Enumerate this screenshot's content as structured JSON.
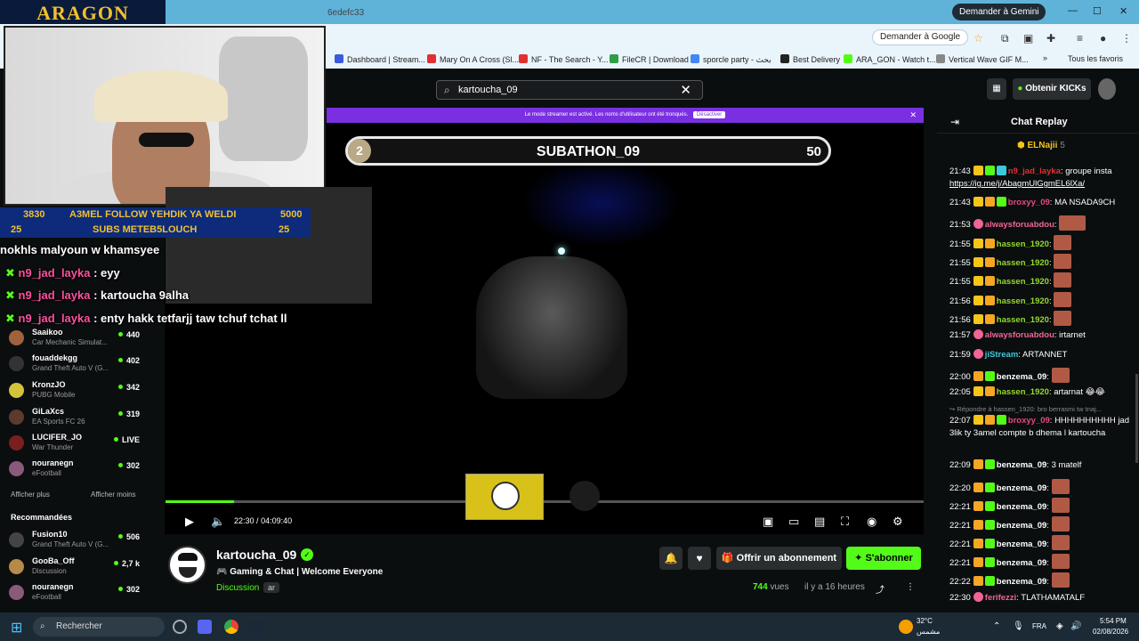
{
  "browser": {
    "gemini_label": "Demander à Gemini",
    "address_tail": "6edefc33",
    "google_btn": "Demander à Google",
    "bookmarks": [
      {
        "label": "Dashboard | Stream...",
        "color": "#3b5bdb"
      },
      {
        "label": "Mary On A Cross (Sl...",
        "color": "#e03131"
      },
      {
        "label": "NF - The Search - Y...",
        "color": "#e03131"
      },
      {
        "label": "FileCR | Download",
        "color": "#2f9e44"
      },
      {
        "label": "sporcle party - بحث",
        "color": "#4285f4"
      },
      {
        "label": "Best Delivery",
        "color": "#222222"
      },
      {
        "label": "ARA_GON - Watch t...",
        "color": "#53fc18"
      },
      {
        "label": "Vertical Wave GIF M...",
        "color": "#888888"
      }
    ],
    "bookmarks_all": "Tous les favoris"
  },
  "kick": {
    "search_value": "kartoucha_09",
    "get_kicks": "Obtenir KICKs",
    "streamer_banner": "Le mode streamer est activé. Les noms d'utilisateur ont été tronqués.",
    "streamer_banner_btn": "Désactiver"
  },
  "overlay": {
    "logo": "ARAGON",
    "goal1_left": "3830",
    "goal1_text": "A3MEL FOLLOW YEHDIK YA WELDI",
    "goal1_right": "5000",
    "goal2_left": "25",
    "goal2_text": "SUBS METEB5LOUCH",
    "goal2_right": "25",
    "messages": [
      {
        "user": "",
        "text": "nokhls malyoun w khamsyee"
      },
      {
        "user": "n9_jad_layka",
        "text": ": eyy"
      },
      {
        "user": "n9_jad_layka",
        "text": ": kartoucha 9alha"
      },
      {
        "user": "n9_jad_layka",
        "text": ": enty hakk tetfarjj taw tchuf tchat ll"
      }
    ],
    "subathon_num": "2",
    "subathon_title": "SUBATHON_09",
    "subathon_right": "50"
  },
  "sidebar": {
    "items": [
      {
        "name": "Saaikoo",
        "cat": "Car Mechanic Simulat...",
        "val": "440"
      },
      {
        "name": "fouaddekgg",
        "cat": "Grand Theft Auto V (G...",
        "val": "402"
      },
      {
        "name": "KronzJO",
        "cat": "PUBG Mobile",
        "val": "342"
      },
      {
        "name": "GiLaXcs",
        "cat": "EA Sports FC 26",
        "val": "319"
      },
      {
        "name": "LUCIFER_JO",
        "cat": "War Thunder",
        "val": "LIVE"
      },
      {
        "name": "nouranegn",
        "cat": "eFootball",
        "val": "302"
      }
    ],
    "show_more": "Afficher plus",
    "show_less": "Afficher moins",
    "recommended": "Recommandées",
    "rec_items": [
      {
        "name": "Fusion10",
        "cat": "Grand Theft Auto V (G...",
        "val": "506"
      },
      {
        "name": "GooBa_Off",
        "cat": "Discussion",
        "val": "2,7 k"
      },
      {
        "name": "nouranegn",
        "cat": "eFootball",
        "val": "302"
      }
    ]
  },
  "player": {
    "time_current": "22:30",
    "time_sep": "/",
    "time_total": "04:09:40",
    "progress": 0.09
  },
  "channel": {
    "name": "kartoucha_09",
    "title": "Gaming & Chat | Welcome Everyone",
    "category": "Discussion",
    "lang": "ar",
    "subscribe_gift": "Offrir un abonnement",
    "subscribe": "S'abonner",
    "viewers": "744",
    "viewers_label": "vues",
    "ago": "il y a 16 heures"
  },
  "chat": {
    "title": "Chat Replay",
    "pinned_user": "ELNajii",
    "pinned_count": "5",
    "reply_note": "Répondre à hassen_1920: bro berrasmi tw tnaj...",
    "messages": [
      {
        "t": "21:43",
        "user": "n9_jad_layka",
        "color": "#e03131",
        "text": ": groupe insta",
        "link": "https://ig.me/j/AbagmUlGgmEL6lXa/"
      },
      {
        "t": "21:43",
        "user": "broxyy_09",
        "color": "#e64980",
        "text": ": MA NSADA9CH"
      },
      {
        "t": "21:53",
        "user": "alwaysforuabdou",
        "color": "#f06595",
        "text": ":"
      },
      {
        "t": "21:55",
        "user": "hassen_1920",
        "color": "#94d82d",
        "text": ":"
      },
      {
        "t": "21:55",
        "user": "hassen_1920",
        "color": "#94d82d",
        "text": ":"
      },
      {
        "t": "21:55",
        "user": "hassen_1920",
        "color": "#94d82d",
        "text": ":"
      },
      {
        "t": "21:56",
        "user": "hassen_1920",
        "color": "#94d82d",
        "text": ":"
      },
      {
        "t": "21:56",
        "user": "hassen_1920",
        "color": "#94d82d",
        "text": ":"
      },
      {
        "t": "21:57",
        "user": "alwaysforuabdou",
        "color": "#f06595",
        "text": ": irtarnet"
      },
      {
        "t": "21:59",
        "user": "jiStream",
        "color": "#3bc9db",
        "text": ": ARTANNET"
      },
      {
        "t": "22:00",
        "user": "benzema_09",
        "color": "#ffffff",
        "text": ":"
      },
      {
        "t": "22:05",
        "user": "hassen_1920",
        "color": "#94d82d",
        "text": ": artarnat"
      },
      {
        "t": "22:07",
        "user": "broxyy_09",
        "color": "#e64980",
        "text": ": HHHHHHHHHH jad 3lik ty 3amel compte b dhema l kartoucha"
      },
      {
        "t": "22:09",
        "user": "benzema_09",
        "color": "#ffffff",
        "text": ": 3 matelf"
      },
      {
        "t": "22:20",
        "user": "benzema_09",
        "color": "#ffffff",
        "text": ":"
      },
      {
        "t": "22:21",
        "user": "benzema_09",
        "color": "#ffffff",
        "text": ":"
      },
      {
        "t": "22:21",
        "user": "benzema_09",
        "color": "#ffffff",
        "text": ":"
      },
      {
        "t": "22:21",
        "user": "benzema_09",
        "color": "#ffffff",
        "text": ":"
      },
      {
        "t": "22:21",
        "user": "benzema_09",
        "color": "#ffffff",
        "text": ":"
      },
      {
        "t": "22:22",
        "user": "benzema_09",
        "color": "#ffffff",
        "text": ":"
      },
      {
        "t": "22:30",
        "user": "ferifezzi",
        "color": "#f06595",
        "text": ": TLATHAMATALF"
      }
    ]
  },
  "taskbar": {
    "search": "Rechercher",
    "weather_temp": "32°C",
    "weather_desc": "مشمس",
    "lang": "FRA",
    "clock": "5:54 PM",
    "date": "02/08/2026"
  }
}
